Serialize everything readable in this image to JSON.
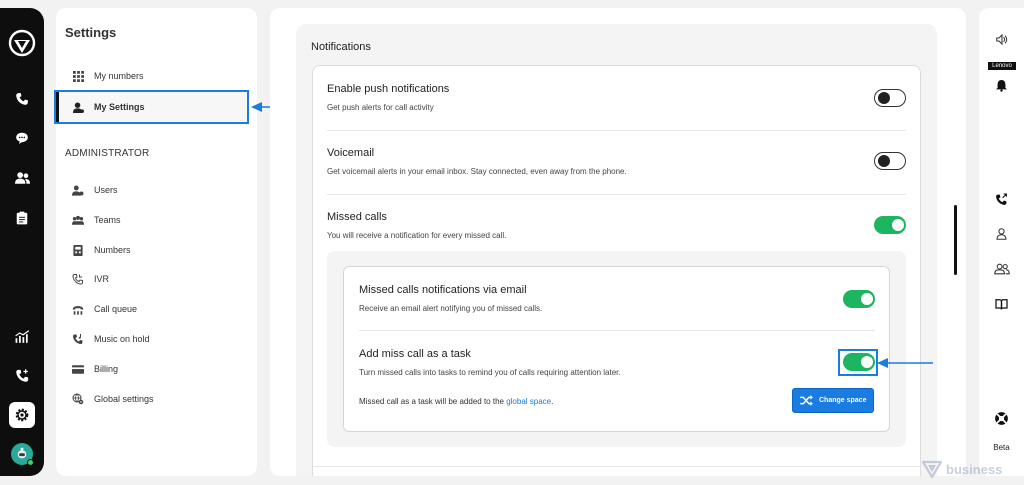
{
  "settings_nav": {
    "title": "Settings",
    "top_items": [
      {
        "label": "My numbers",
        "icon": "grid-icon"
      },
      {
        "label": "My Settings",
        "icon": "user-settings-icon"
      }
    ],
    "admin_header": "ADMINISTRATOR",
    "admin_items": [
      {
        "label": "Users",
        "icon": "users-icon"
      },
      {
        "label": "Teams",
        "icon": "teams-icon"
      },
      {
        "label": "Numbers",
        "icon": "numbers-icon"
      },
      {
        "label": "IVR",
        "icon": "ivr-icon"
      },
      {
        "label": "Call queue",
        "icon": "call-queue-icon"
      },
      {
        "label": "Music on hold",
        "icon": "music-on-hold-icon"
      },
      {
        "label": "Billing",
        "icon": "billing-icon"
      },
      {
        "label": "Global settings",
        "icon": "globe-settings-icon"
      }
    ]
  },
  "notifications": {
    "section_title": "Notifications",
    "push": {
      "title": "Enable push notifications",
      "description": "Get push alerts for call activity",
      "enabled": false
    },
    "voicemail": {
      "title": "Voicemail",
      "description": "Get voicemail alerts in your email inbox. Stay connected, even away from the phone.",
      "enabled": false
    },
    "missed": {
      "title": "Missed calls",
      "description": "You will receive a notification for every missed call.",
      "enabled": true
    },
    "missed_email": {
      "title": "Missed calls notifications via email",
      "description": "Receive an email alert notifying you of missed calls.",
      "enabled": true
    },
    "missed_task": {
      "title": "Add miss call as a task",
      "description": "Turn missed calls into tasks to remind you of calls requiring attention later.",
      "enabled": true,
      "footer_prefix": "Missed call as a task will be added to the",
      "footer_link": "global space",
      "footer_suffix": ".",
      "change_button": "Change space"
    }
  },
  "right_rail": {
    "device_label": "Lenovo",
    "beta_label": "Beta"
  },
  "watermark": "business",
  "colors": {
    "accent": "#1a7be0",
    "toggle_on": "#1eb561",
    "rail": "#0e0e0e"
  }
}
